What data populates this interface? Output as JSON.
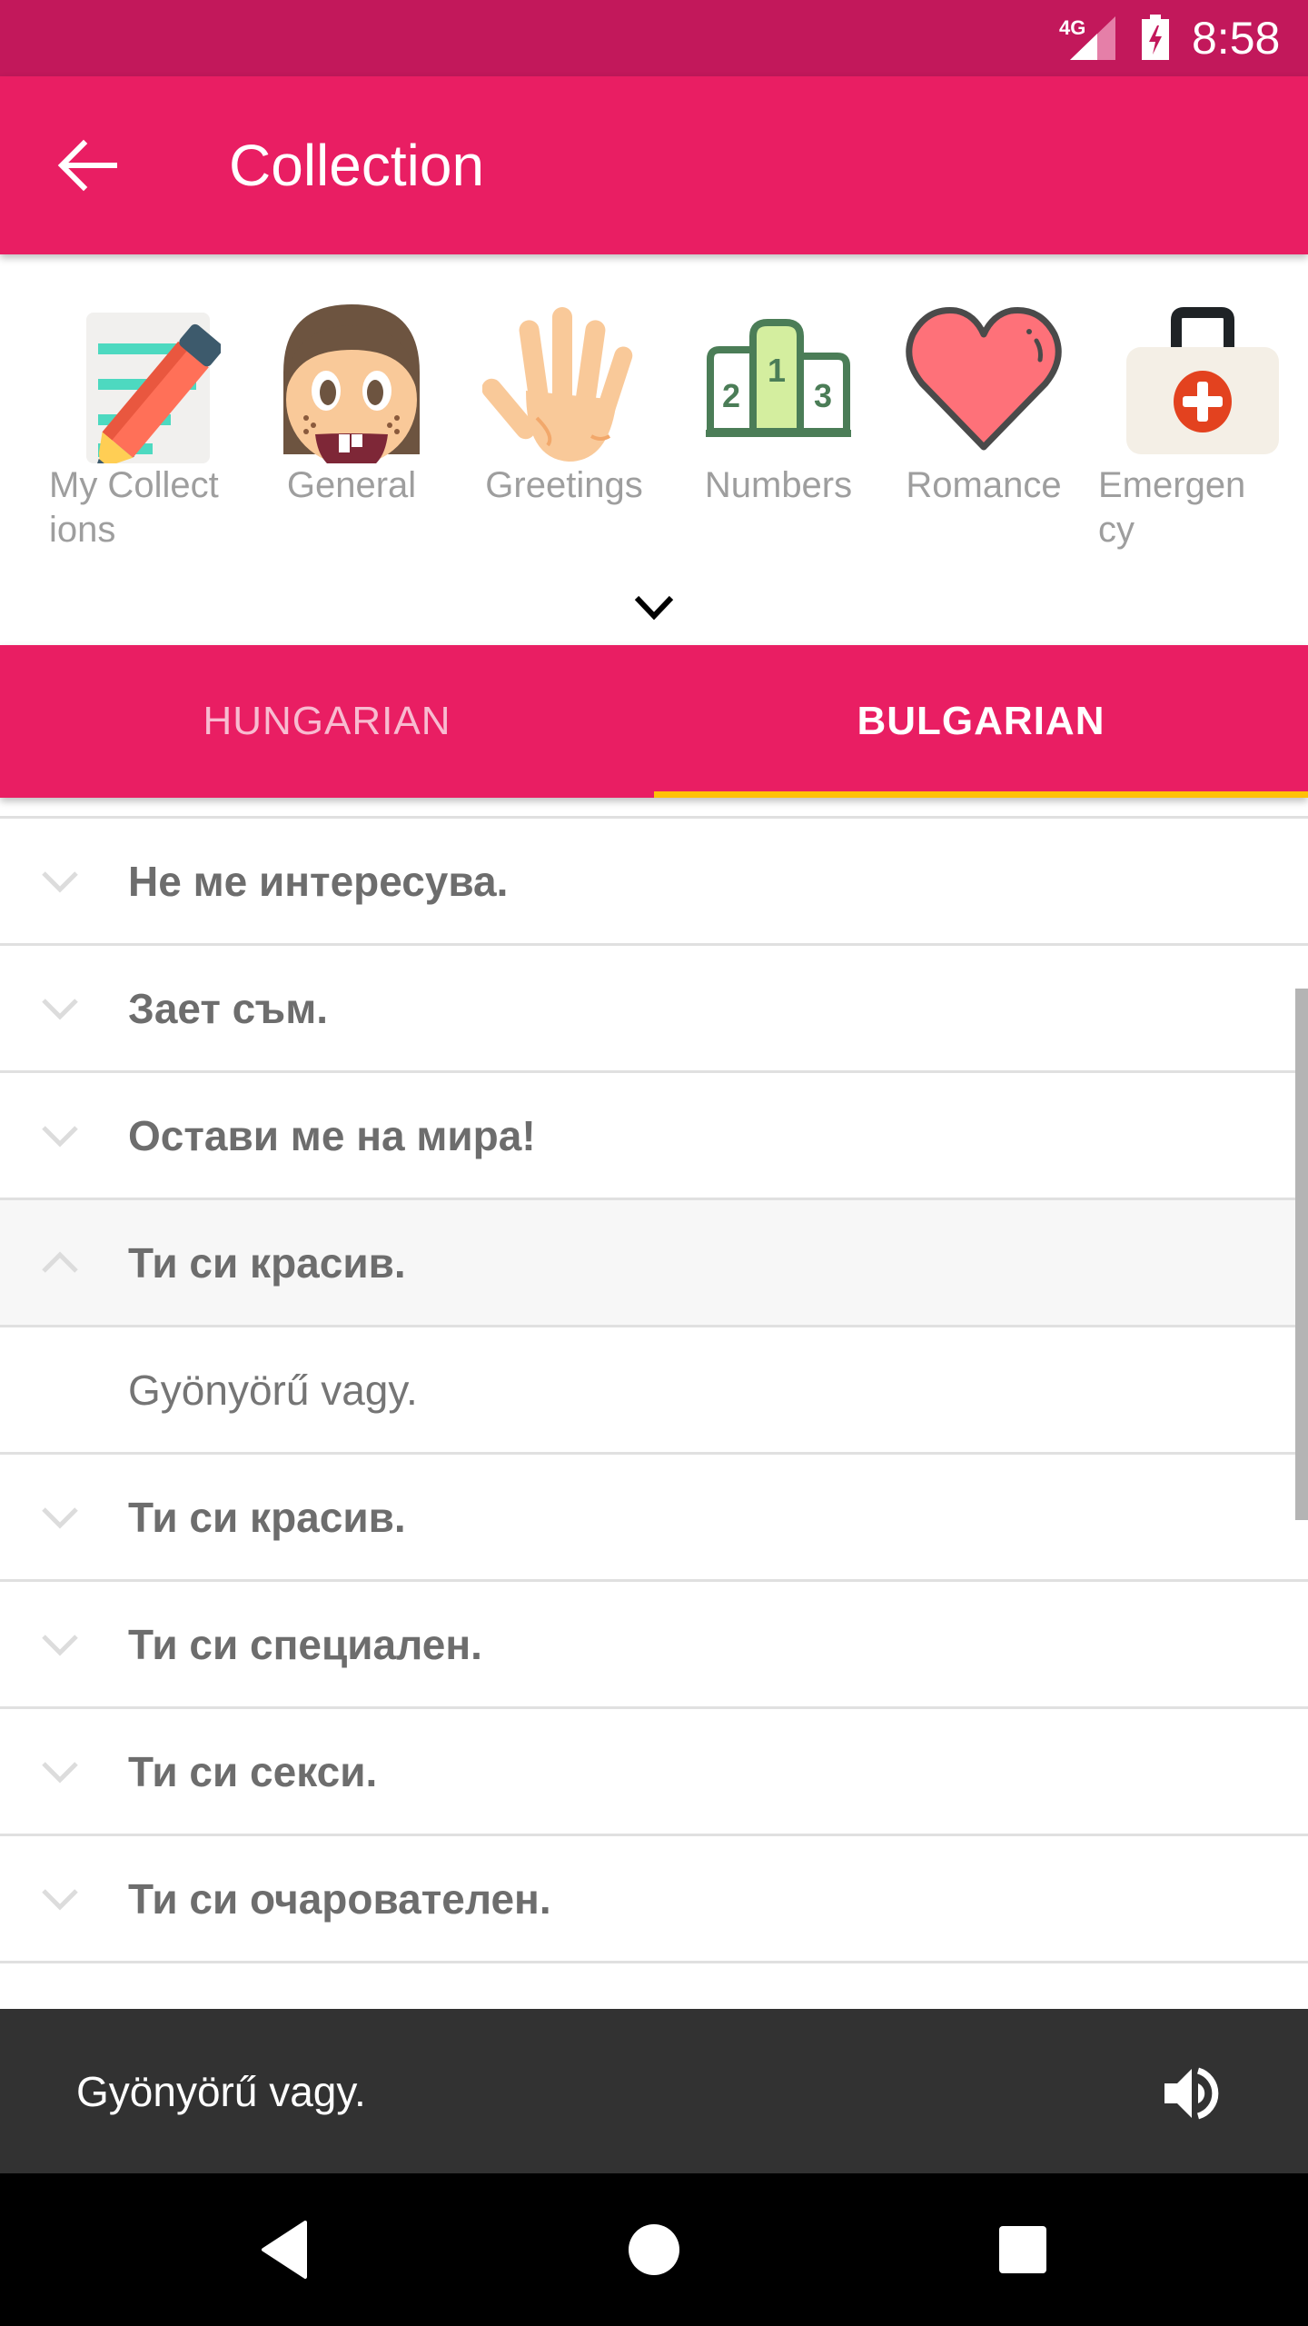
{
  "status_bar": {
    "network": "4G",
    "time": "8:58"
  },
  "app_bar": {
    "title": "Collection",
    "back_icon": "arrow-back-icon"
  },
  "categories": {
    "items": [
      {
        "label": "My Collect\nions",
        "icon": "notepad-pencil-icon"
      },
      {
        "label": "General",
        "icon": "girl-face-icon"
      },
      {
        "label": "Greetings",
        "icon": "waving-hand-icon"
      },
      {
        "label": "Numbers",
        "icon": "podium-icon"
      },
      {
        "label": "Romance",
        "icon": "heart-icon"
      },
      {
        "label": "Emergen\ncy",
        "icon": "first-aid-kit-icon"
      }
    ],
    "expand_icon": "chevron-down-icon"
  },
  "tabs": [
    {
      "label": "HUNGARIAN",
      "active": false
    },
    {
      "label": "BULGARIAN",
      "active": true
    }
  ],
  "colors": {
    "primary": "#e91e63",
    "primary_dark": "#c2185b",
    "tab_indicator": "#ffc107",
    "player_bg": "#323232"
  },
  "phrases": [
    {
      "text": "Не ме интересува.",
      "expanded": false
    },
    {
      "text": "Зает съм.",
      "expanded": false
    },
    {
      "text": "Остави ме на мира!",
      "expanded": false
    },
    {
      "text": "Ти си красив.",
      "expanded": true,
      "translation": "Gyönyörű vagy."
    },
    {
      "text": "Ти си красив.",
      "expanded": false
    },
    {
      "text": "Ти си специален.",
      "expanded": false
    },
    {
      "text": "Ти си секси.",
      "expanded": false
    },
    {
      "text": "Ти си очарователен.",
      "expanded": false
    }
  ],
  "player": {
    "text": "Gyönyörű vagy.",
    "icon": "speaker-icon"
  },
  "nav_bar": {
    "buttons": [
      "back",
      "home",
      "recents"
    ]
  }
}
